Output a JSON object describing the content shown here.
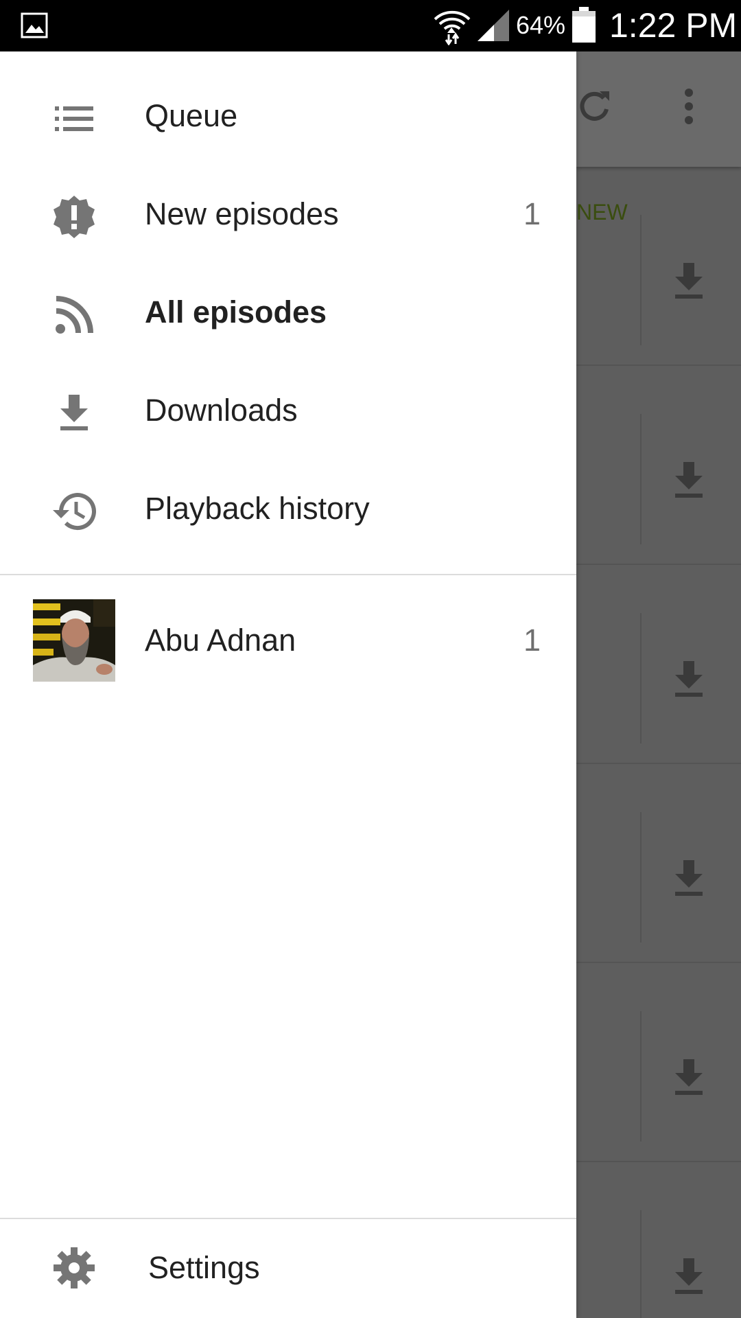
{
  "status_bar": {
    "battery_percent": "64%",
    "time": "1:22 PM",
    "icons": [
      "gallery-icon",
      "wifi-icon",
      "cell-signal-icon",
      "battery-icon"
    ]
  },
  "background": {
    "new_badge": "NEW",
    "toolbar_icons": [
      "refresh-icon",
      "more-vert-icon"
    ]
  },
  "drawer": {
    "nav_items": [
      {
        "label": "Queue",
        "icon": "queue-list-icon",
        "count": ""
      },
      {
        "label": "New episodes",
        "icon": "new-episodes-icon",
        "count": "1"
      },
      {
        "label": "All episodes",
        "icon": "rss-feed-icon",
        "count": "",
        "selected": true
      },
      {
        "label": "Downloads",
        "icon": "download-icon",
        "count": ""
      },
      {
        "label": "Playback history",
        "icon": "history-icon",
        "count": ""
      }
    ],
    "subscriptions": [
      {
        "label": "Abu Adnan",
        "count": "1"
      }
    ],
    "settings_label": "Settings"
  },
  "colors": {
    "drawer_bg": "#ffffff",
    "scrim": "#5e5e5e",
    "text_primary": "#212121",
    "icon_gray": "#757575",
    "new_badge": "#3a4d0f"
  }
}
